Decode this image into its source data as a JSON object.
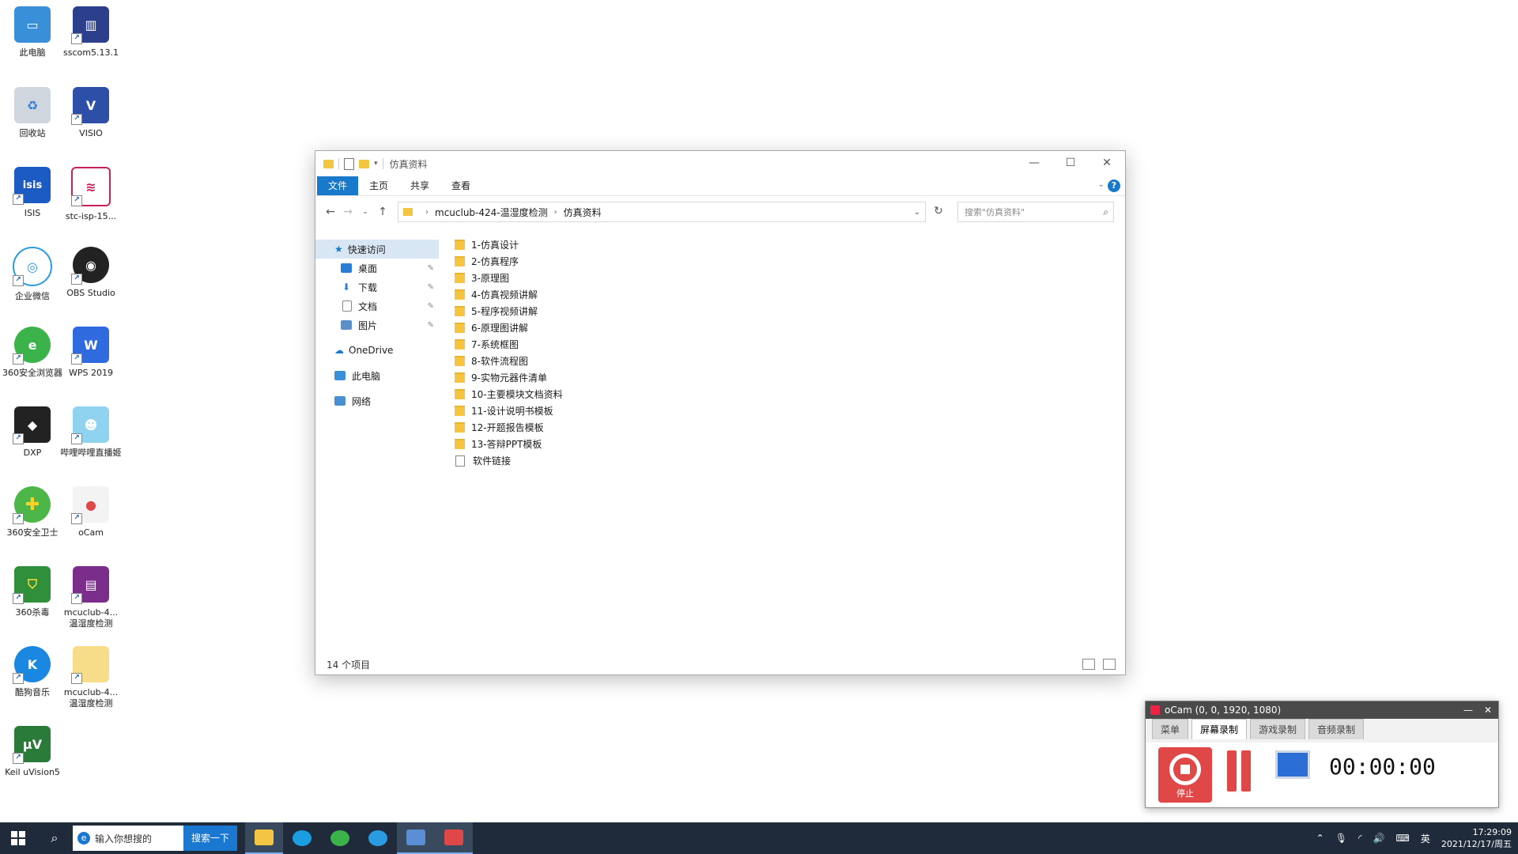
{
  "desktop": {
    "icons": [
      {
        "label": "此电脑"
      },
      {
        "label": "sscom5.13.1"
      },
      {
        "label": "回收站"
      },
      {
        "label": "VISIO"
      },
      {
        "label": "ISIS"
      },
      {
        "label": "stc-isp-15..."
      },
      {
        "label": "企业微信"
      },
      {
        "label": "OBS Studio"
      },
      {
        "label": "360安全浏览器"
      },
      {
        "label": "WPS 2019"
      },
      {
        "label": "DXP"
      },
      {
        "label": "哔哩哔哩直播姬"
      },
      {
        "label": "360安全卫士"
      },
      {
        "label": "oCam"
      },
      {
        "label": "360杀毒"
      },
      {
        "label": "mcuclub-4...温湿度检测"
      },
      {
        "label": "酷狗音乐"
      },
      {
        "label": "mcuclub-4...温湿度检测"
      },
      {
        "label": "Keil uVision5"
      }
    ]
  },
  "explorer": {
    "title": "仿真资料",
    "ribbon_tabs": {
      "file": "文件",
      "home": "主页",
      "share": "共享",
      "view": "查看"
    },
    "breadcrumb": {
      "part1": "mcuclub-424-温湿度检测",
      "part2": "仿真资料"
    },
    "search_placeholder": "搜索\"仿真资料\"",
    "nav": {
      "quick_access": "快速访问",
      "desktop": "桌面",
      "downloads": "下载",
      "documents": "文档",
      "pictures": "图片",
      "onedrive": "OneDrive",
      "this_pc": "此电脑",
      "network": "网络"
    },
    "files": [
      {
        "name": "1-仿真设计",
        "type": "folder"
      },
      {
        "name": "2-仿真程序",
        "type": "folder"
      },
      {
        "name": "3-原理图",
        "type": "folder"
      },
      {
        "name": "4-仿真视频讲解",
        "type": "folder"
      },
      {
        "name": "5-程序视频讲解",
        "type": "folder"
      },
      {
        "name": "6-原理图讲解",
        "type": "folder"
      },
      {
        "name": "7-系统框图",
        "type": "folder"
      },
      {
        "name": "8-软件流程图",
        "type": "folder"
      },
      {
        "name": "9-实物元器件清单",
        "type": "folder"
      },
      {
        "name": "10-主要模块文档资料",
        "type": "folder"
      },
      {
        "name": "11-设计说明书模板",
        "type": "folder"
      },
      {
        "name": "12-开题报告模板",
        "type": "folder"
      },
      {
        "name": "13-答辩PPT模板",
        "type": "folder"
      },
      {
        "name": "软件链接",
        "type": "file"
      }
    ],
    "status_count": "14 个项目"
  },
  "ocam": {
    "title": "oCam (0, 0, 1920, 1080)",
    "tabs": {
      "menu": "菜单",
      "screen": "屏幕录制",
      "game": "游戏录制",
      "audio": "音频录制"
    },
    "stop_label": "停止",
    "timer": "00:00:00"
  },
  "taskbar": {
    "search_placeholder": "输入你想搜的",
    "search_button": "搜索一下",
    "ime": "英",
    "time": "17:29:09",
    "date": "2021/12/17/周五"
  },
  "colors": {
    "accent": "#1979ca",
    "folder": "#f5c542",
    "record": "#e04848",
    "taskbar": "#1f2b3a"
  }
}
